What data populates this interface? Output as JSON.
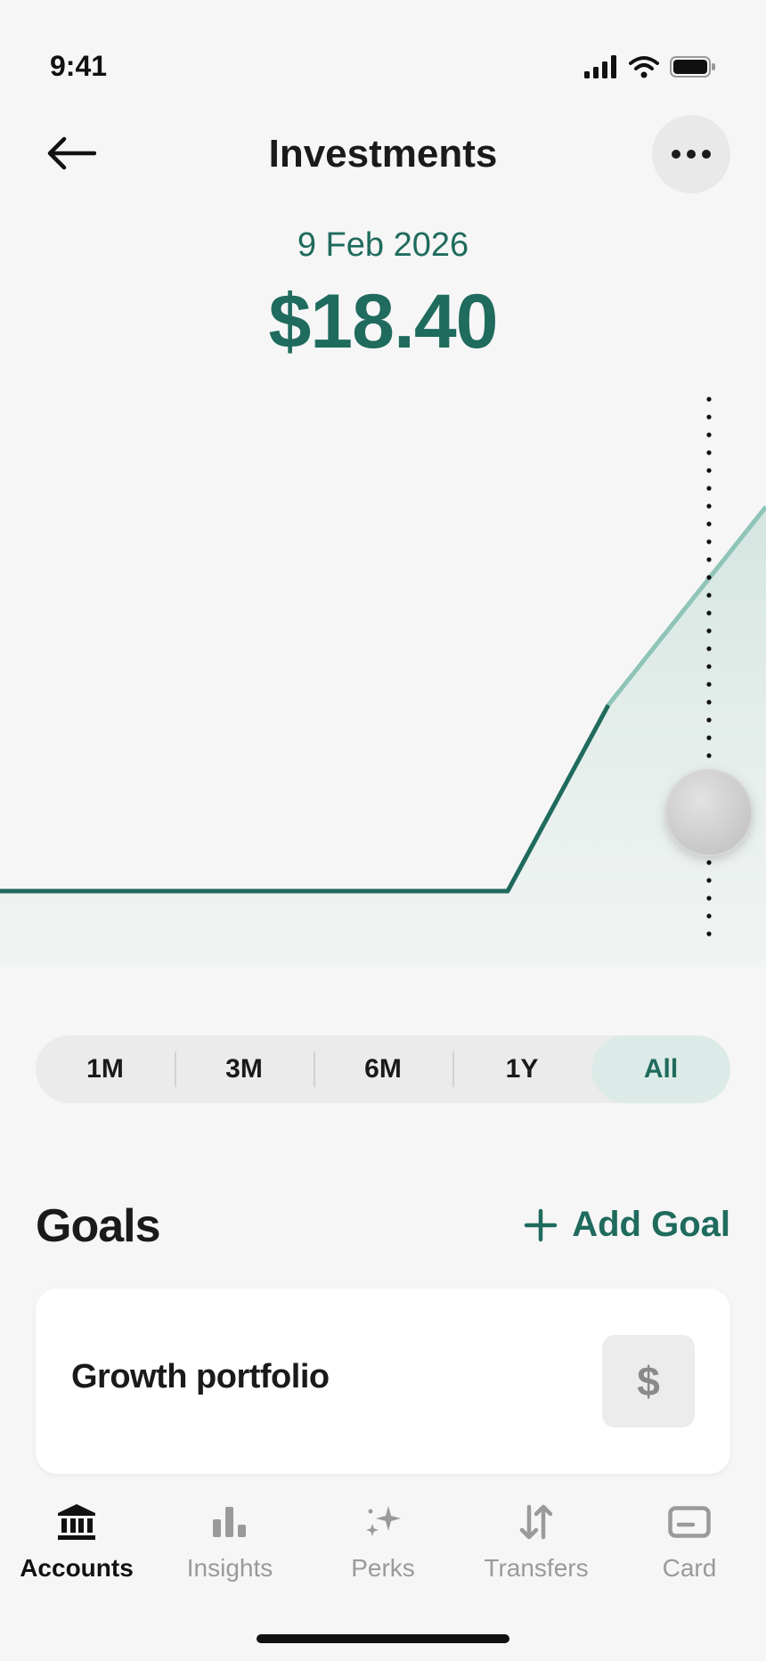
{
  "status": {
    "time": "9:41"
  },
  "header": {
    "title": "Investments"
  },
  "selection": {
    "date": "9 Feb 2026",
    "value": "$18.40"
  },
  "chart_data": {
    "type": "area",
    "x": [
      "",
      "",
      "",
      ""
    ],
    "values": [
      0,
      0,
      18.4,
      38
    ],
    "selected_index": 2,
    "ylim": [
      0,
      40
    ],
    "grid": false,
    "colors": {
      "line": "#1f6b5e",
      "future_line": "#8fc4b8",
      "fill": "#d4e5e0"
    }
  },
  "ranges": [
    {
      "label": "1M",
      "active": false
    },
    {
      "label": "3M",
      "active": false
    },
    {
      "label": "6M",
      "active": false
    },
    {
      "label": "1Y",
      "active": false
    },
    {
      "label": "All",
      "active": true
    }
  ],
  "goals": {
    "title": "Goals",
    "add_label": "Add Goal",
    "items": [
      {
        "name": "Growth portfolio",
        "icon": "$"
      }
    ]
  },
  "tabs": [
    {
      "label": "Accounts",
      "icon": "bank-icon",
      "active": true
    },
    {
      "label": "Insights",
      "icon": "bar-chart-icon",
      "active": false
    },
    {
      "label": "Perks",
      "icon": "sparkle-icon",
      "active": false
    },
    {
      "label": "Transfers",
      "icon": "transfer-arrows-icon",
      "active": false
    },
    {
      "label": "Card",
      "icon": "card-icon",
      "active": false
    }
  ],
  "colors": {
    "accent": "#1f6b5e",
    "background": "#f6f6f6"
  }
}
